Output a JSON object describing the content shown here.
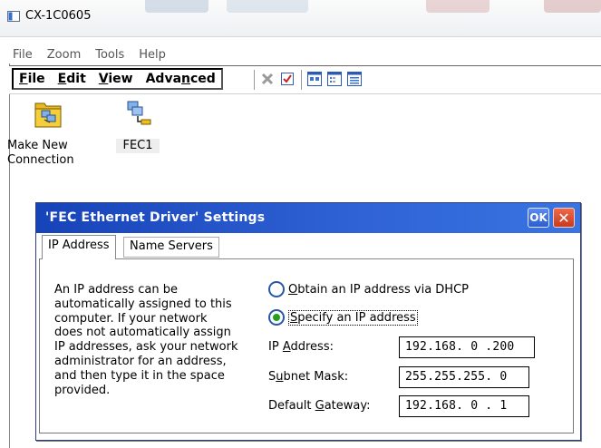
{
  "window": {
    "title": "CX-1C0605"
  },
  "outer_menu": [
    "File",
    "Zoom",
    "Tools",
    "Help"
  ],
  "ce_menu": [
    {
      "label": "File",
      "accel_prefix": "",
      "accel": "F",
      "rest": "ile"
    },
    {
      "label": "Edit",
      "accel_prefix": "",
      "accel": "E",
      "rest": "dit"
    },
    {
      "label": "View",
      "accel_prefix": "",
      "accel": "V",
      "rest": "iew"
    },
    {
      "label": "Advanced",
      "accel_prefix": "Adva",
      "accel": "n",
      "rest": "ced"
    }
  ],
  "toolbar": {
    "buttons": [
      "delete-icon",
      "properties-icon",
      "large-icons-view-icon",
      "small-icons-view-icon",
      "details-view-icon"
    ]
  },
  "desktop_icons": [
    {
      "line1": "Make New",
      "line2": "Connection",
      "icon": "make-new-connection-icon"
    },
    {
      "line1": "FEC1",
      "line2": "",
      "icon": "network-connection-icon"
    }
  ],
  "dialog": {
    "title": "'FEC Ethernet Driver' Settings",
    "ok_label": "OK",
    "close_label": "✕",
    "tabs": [
      {
        "label": "IP Address",
        "active": true
      },
      {
        "label": "Name Servers",
        "active": false
      }
    ],
    "description_lines": [
      "An IP address can be",
      "automatically assigned to this",
      "computer.  If your network",
      "does not automatically assign",
      "IP addresses, ask your network",
      "administrator for an address,",
      "and then type it in the space",
      "provided."
    ],
    "radio_dhcp": {
      "accel": "O",
      "rest": "btain an IP address via DHCP",
      "selected": false
    },
    "radio_specify": {
      "accel": "S",
      "rest": "pecify an IP address",
      "selected": true
    },
    "fields": {
      "ip_address": {
        "label_pre": "IP ",
        "accel": "A",
        "label_post": "ddress:",
        "value": "192.168. 0 .200"
      },
      "subnet_mask": {
        "label_pre": "S",
        "accel": "u",
        "label_post": "bnet Mask:",
        "value": "255.255.255. 0"
      },
      "default_gateway": {
        "label_pre": "Default ",
        "accel": "G",
        "label_post": "ateway:",
        "value": "192.168. 0 . 1"
      }
    }
  },
  "colors": {
    "title_blue": "#1743b8",
    "close_red": "#c73a1e",
    "radio_green": "#22a022"
  }
}
